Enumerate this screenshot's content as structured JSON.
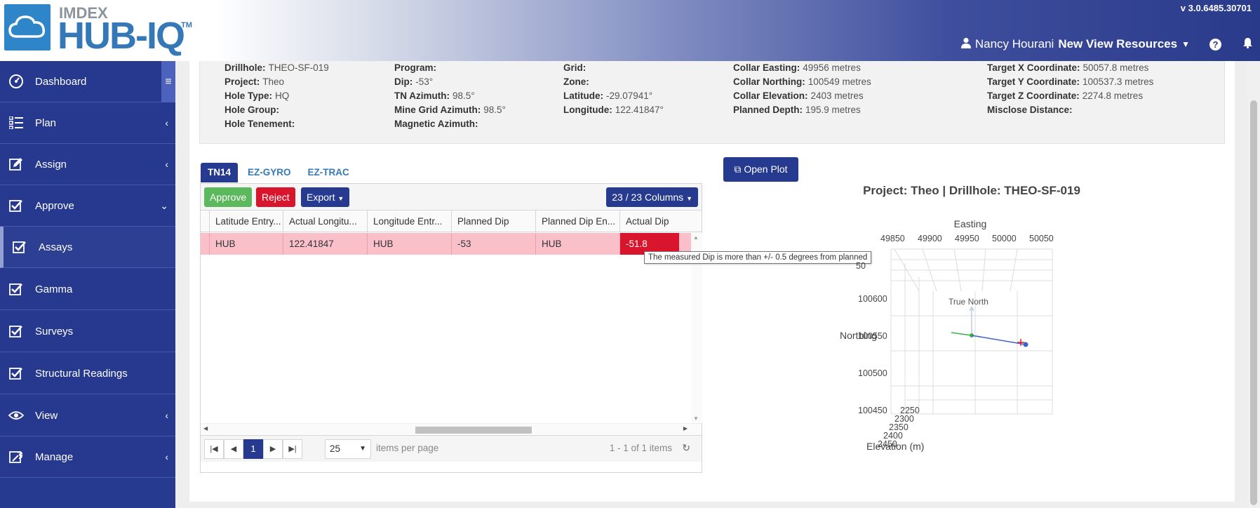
{
  "header": {
    "brand_top": "IMDEX",
    "brand_main": "HUB-IQ",
    "brand_tm": "TM",
    "version": "v 3.0.6485.30701",
    "user_name": "Nancy Hourani",
    "org_name": "New View Resources",
    "help": "?"
  },
  "sidebar": {
    "items": [
      {
        "label": "Dashboard",
        "icon": "dashboard-icon"
      },
      {
        "label": "Plan",
        "icon": "list-icon"
      },
      {
        "label": "Assign",
        "icon": "edit-icon"
      },
      {
        "label": "Approve",
        "icon": "checkbox-icon"
      },
      {
        "label": "Assays",
        "icon": "checkbox-icon"
      },
      {
        "label": "Gamma",
        "icon": "checkbox-icon"
      },
      {
        "label": "Surveys",
        "icon": "checkbox-icon"
      },
      {
        "label": "Structural Readings",
        "icon": "checkbox-icon"
      },
      {
        "label": "View",
        "icon": "eye-icon"
      },
      {
        "label": "Manage",
        "icon": "wrench-icon"
      }
    ]
  },
  "info": {
    "col1": [
      {
        "k": "Drillhole:",
        "v": "THEO-SF-019"
      },
      {
        "k": "Project:",
        "v": "Theo"
      },
      {
        "k": "Hole Type:",
        "v": "HQ"
      },
      {
        "k": "Hole Group:",
        "v": ""
      },
      {
        "k": "Hole Tenement:",
        "v": ""
      }
    ],
    "col2": [
      {
        "k": "Program:",
        "v": ""
      },
      {
        "k": "Dip:",
        "v": "-53°"
      },
      {
        "k": "TN Azimuth:",
        "v": "98.5°"
      },
      {
        "k": "Mine Grid Azimuth:",
        "v": "98.5°"
      },
      {
        "k": "Magnetic Azimuth:",
        "v": ""
      }
    ],
    "col3": [
      {
        "k": "Grid:",
        "v": ""
      },
      {
        "k": "Zone:",
        "v": ""
      },
      {
        "k": "Latitude:",
        "v": "-29.07941°"
      },
      {
        "k": "Longitude:",
        "v": "122.41847°"
      }
    ],
    "col4": [
      {
        "k": "Collar Easting:",
        "v": "49956 metres"
      },
      {
        "k": "Collar Northing:",
        "v": "100549 metres"
      },
      {
        "k": "Collar Elevation:",
        "v": "2403 metres"
      },
      {
        "k": "Planned Depth:",
        "v": "195.9 metres"
      }
    ],
    "col5": [
      {
        "k": "Target X Coordinate:",
        "v": "50057.8 metres"
      },
      {
        "k": "Target Y Coordinate:",
        "v": "100537.3 metres"
      },
      {
        "k": "Target Z Coordinate:",
        "v": "2274.8 metres"
      },
      {
        "k": "Misclose Distance:",
        "v": ""
      }
    ]
  },
  "tabs": [
    "TN14",
    "EZ-GYRO",
    "EZ-TRAC"
  ],
  "toolbar": {
    "approve": "Approve",
    "reject": "Reject",
    "export": "Export",
    "columns": "23 / 23 Columns"
  },
  "grid": {
    "headers": [
      "Latitude Entry...",
      "Actual Longitu...",
      "Longitude Entr...",
      "Planned Dip",
      "Planned Dip En...",
      "Actual Dip"
    ],
    "row": [
      "HUB",
      "122.41847",
      "HUB",
      "-53",
      "HUB",
      "-51.8"
    ]
  },
  "pager": {
    "page": "1",
    "page_size": "25",
    "items_per_page": "items per page",
    "info": "1 - 1 of 1 items"
  },
  "tooltip": "The measured Dip is more than +/- 0.5 degrees from planned",
  "plot": {
    "button": "Open Plot",
    "title": "Project: Theo | Drillhole: THEO-SF-019",
    "easting_label": "Easting",
    "easting_ticks": [
      "49850",
      "49900",
      "49950",
      "50000",
      "50050"
    ],
    "northing_label": "Northing",
    "northing_ticks": [
      "100600",
      "100550",
      "100500",
      "100450"
    ],
    "elevation_label": "Elevation (m)",
    "elevation_ticks": [
      "2250",
      "2300",
      "2350",
      "2400",
      "2450"
    ],
    "true_north": "True North",
    "partial_tick": "50"
  }
}
